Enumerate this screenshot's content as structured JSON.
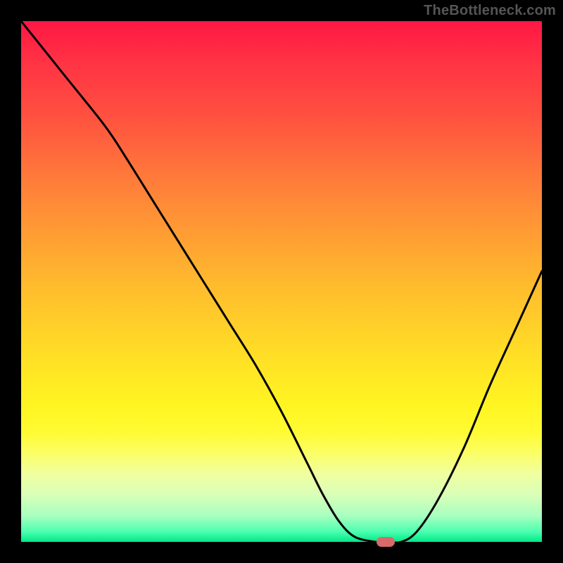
{
  "watermark": "TheBottleneck.com",
  "chart_data": {
    "type": "line",
    "title": "",
    "xlabel": "",
    "ylabel": "",
    "xlim": [
      0,
      100
    ],
    "ylim": [
      0,
      100
    ],
    "grid": false,
    "x": [
      0,
      8,
      16,
      20,
      25,
      30,
      35,
      40,
      45,
      50,
      55,
      58,
      61,
      64,
      68,
      70,
      73,
      76,
      80,
      85,
      90,
      95,
      100
    ],
    "values": [
      100,
      90,
      80,
      74,
      66,
      58,
      50,
      42,
      34,
      25,
      15,
      9,
      4,
      1,
      0,
      0,
      0,
      2,
      8,
      18,
      30,
      41,
      52
    ],
    "series": [
      {
        "name": "bottleneck-curve",
        "x_ref": "x",
        "y_ref": "values"
      }
    ],
    "marker": {
      "x": 70,
      "y": 0,
      "color": "#d86a6a"
    },
    "background_gradient": {
      "top": "#ff1744",
      "mid": "#ffd428",
      "bottom": "#00e888"
    }
  }
}
